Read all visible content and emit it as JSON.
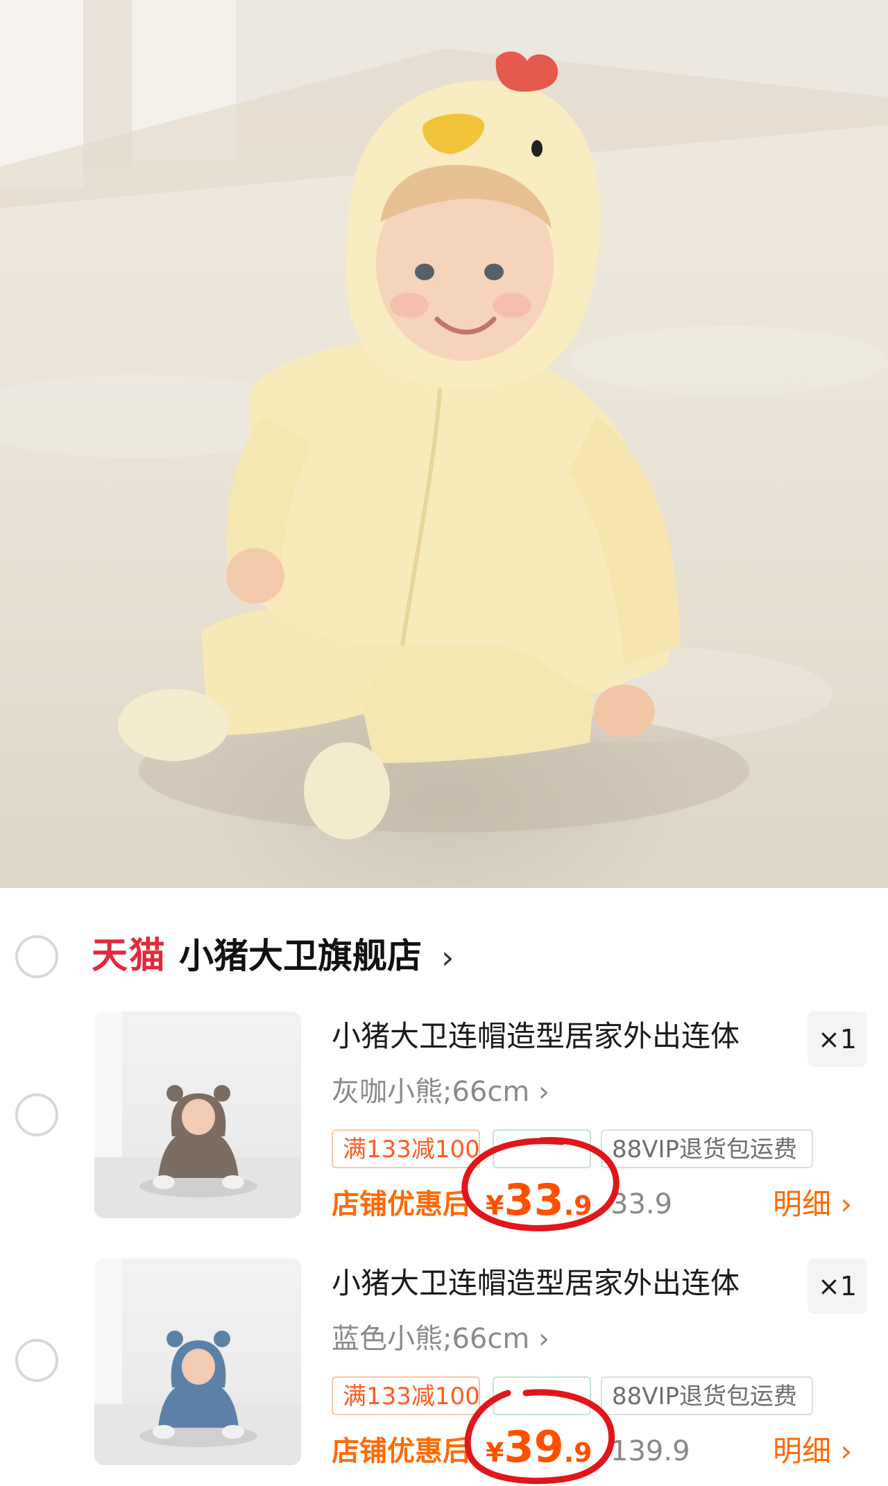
{
  "hero": {
    "alt_icon": "baby-chick-onesie-photo"
  },
  "store": {
    "platform_label": "天猫",
    "name": "小猪大卫旗舰店",
    "chevron": "›"
  },
  "items": [
    {
      "title": "小猪大卫连帽造型居家外出连体",
      "quantity": "×1",
      "variant": "灰咖小熊;66cm ›",
      "promo_tag": "满133减100",
      "mid_tag": "",
      "vip_tag": "88VIP退货包运费",
      "shop_discount_label": "店铺优惠后",
      "price_currency": "¥",
      "price_integer": "33",
      "price_decimal": ".9",
      "original_price": "33.9",
      "detail_label": "明细 ›",
      "bear_color": "#7b6d62"
    },
    {
      "title": "小猪大卫连帽造型居家外出连体",
      "quantity": "×1",
      "variant": "蓝色小熊;66cm ›",
      "promo_tag": "满133减100",
      "mid_tag": "",
      "vip_tag": "88VIP退货包运费",
      "shop_discount_label": "店铺优惠后",
      "price_currency": "¥",
      "price_integer": "39",
      "price_decimal": ".9",
      "original_price": "139.9",
      "detail_label": "明细 ›",
      "bear_color": "#5b82a6"
    }
  ],
  "colors": {
    "tmall_red": "#e4293c",
    "price_orange": "#ff5000",
    "annotation_red": "#e0161b"
  }
}
